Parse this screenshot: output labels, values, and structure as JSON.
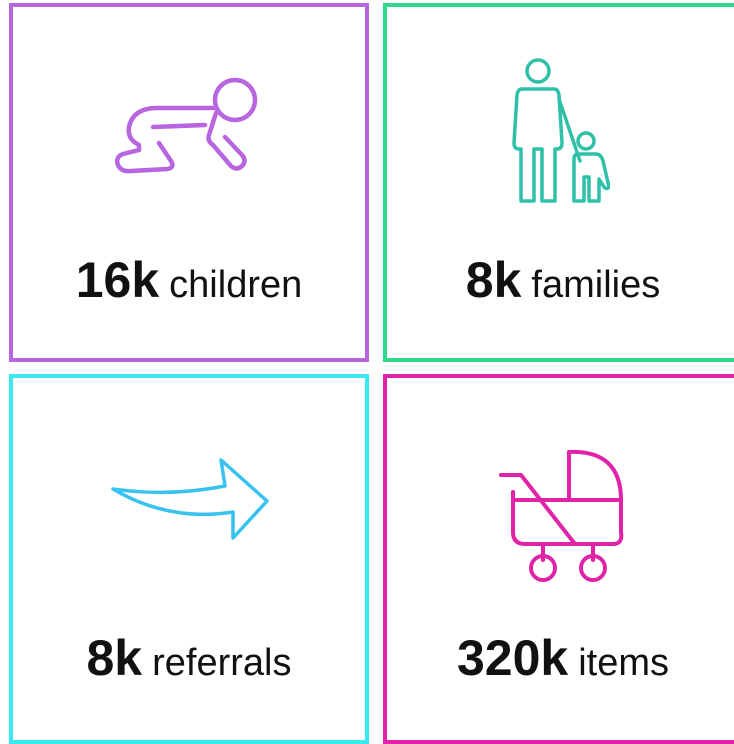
{
  "tiles": {
    "children": {
      "value": "16k",
      "unit": "children",
      "icon": "crawling-baby-icon",
      "color": "#b865e0"
    },
    "families": {
      "value": "8k",
      "unit": "families",
      "icon": "parent-child-icon",
      "color": "#2ed98c"
    },
    "referrals": {
      "value": "8k",
      "unit": "referrals",
      "icon": "arrow-right-icon",
      "color": "#38eaf0"
    },
    "items": {
      "value": "320k",
      "unit": "items",
      "icon": "stroller-icon",
      "color": "#e023a8"
    }
  }
}
